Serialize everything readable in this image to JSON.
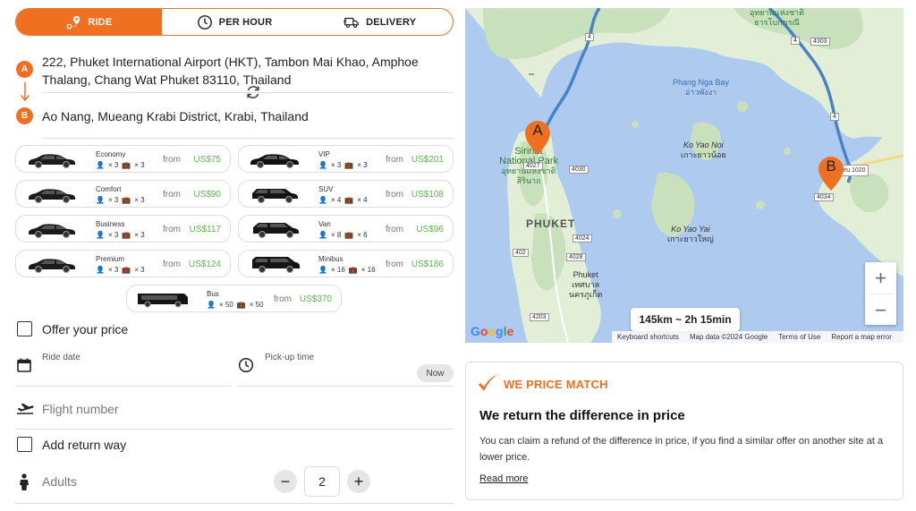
{
  "tabs": [
    {
      "label": "RIDE",
      "icon": "route-pin-icon",
      "active": true
    },
    {
      "label": "PER HOUR",
      "icon": "clock-icon",
      "active": false
    },
    {
      "label": "DELIVERY",
      "icon": "truck-icon",
      "active": false
    }
  ],
  "route": {
    "from_pin": "A",
    "from": "222, Phuket International Airport (HKT), Tambon Mai Khao, Amphoe Thalang, Chang Wat Phuket 83110, Thailand",
    "to_pin": "B",
    "to": "Ao Nang, Mueang Krabi District, Krabi, Thailand"
  },
  "vehicles": [
    {
      "name": "Economy",
      "passengers": "× 3",
      "bags": "× 3",
      "from": "from",
      "price": "US$75"
    },
    {
      "name": "VIP",
      "passengers": "× 3",
      "bags": "× 3",
      "from": "from",
      "price": "US$201"
    },
    {
      "name": "Comfort",
      "passengers": "× 3",
      "bags": "× 3",
      "from": "from",
      "price": "US$90"
    },
    {
      "name": "SUV",
      "passengers": "× 4",
      "bags": "× 4",
      "from": "from",
      "price": "US$108"
    },
    {
      "name": "Business",
      "passengers": "× 3",
      "bags": "× 3",
      "from": "from",
      "price": "US$117"
    },
    {
      "name": "Van",
      "passengers": "× 8",
      "bags": "× 6",
      "from": "from",
      "price": "US$96"
    },
    {
      "name": "Premium",
      "passengers": "× 3",
      "bags": "× 3",
      "from": "from",
      "price": "US$124"
    },
    {
      "name": "Minibus",
      "passengers": "× 16",
      "bags": "× 16",
      "from": "from",
      "price": "US$186"
    },
    {
      "name": "Bus",
      "passengers": "× 50",
      "bags": "× 50",
      "from": "from",
      "price": "US$370"
    }
  ],
  "form": {
    "offer_price": "Offer your price",
    "ride_date": "Ride date",
    "pickup_time": "Pick-up time",
    "now": "Now",
    "flight_number": "Flight number",
    "return_way": "Add return way",
    "adults_label": "Adults",
    "adults_value": "2",
    "minus": "−",
    "plus": "+"
  },
  "map": {
    "labels": {
      "phang_nga_bay": "Phang Nga Bay",
      "phang_nga_bay_th": "อ่าวพังงา",
      "ko_yao_noi": "Ko Yao Noi",
      "ko_yao_noi_th": "เกาะยาวน้อย",
      "ko_yao_yai": "Ko Yao Yai",
      "ko_yao_yai_th": "เกาะยาวใหญ่",
      "sirinat": "Sirinat",
      "national_park": "National Park",
      "national_park_th": "อุทยานแห่งชาติ",
      "sirinat_th": "สิรินาถ",
      "phuket": "PHUKET",
      "phuket_town": "Phuket",
      "phuket_town_th1": "เทศบาล",
      "phuket_town_th2": "นครภูเก็ต",
      "top_right_th1": "อุทยานแห่งชาติ",
      "top_right_th2": "ธารโบกขรณี"
    },
    "roads": [
      "4",
      "4",
      "4",
      "4027",
      "4030",
      "402",
      "4024",
      "4028",
      "4203",
      "4034",
      "ทบ.1020",
      "4303"
    ],
    "marker_a": "A",
    "marker_b": "B",
    "distance": "145km  ~ 2h 15min",
    "zoom_in": "+",
    "zoom_out": "−",
    "google": "Google",
    "footer": [
      "Keyboard shortcuts",
      "Map data ©2024 Google",
      "Terms of Use",
      "Report a map error"
    ],
    "colors": {
      "water": "#aecbef",
      "land": "#e6efd9",
      "forest": "#cfe3c2",
      "route": "#4a82c8",
      "marker": "#f07022"
    }
  },
  "price_match": {
    "title": "WE PRICE MATCH",
    "heading": "We return the difference in price",
    "body": "You can claim a refund of the difference in price, if you find a similar offer on another site at a lower price.",
    "link": "Read more"
  },
  "colors": {
    "accent": "#f07022",
    "price": "#5bb84d"
  }
}
